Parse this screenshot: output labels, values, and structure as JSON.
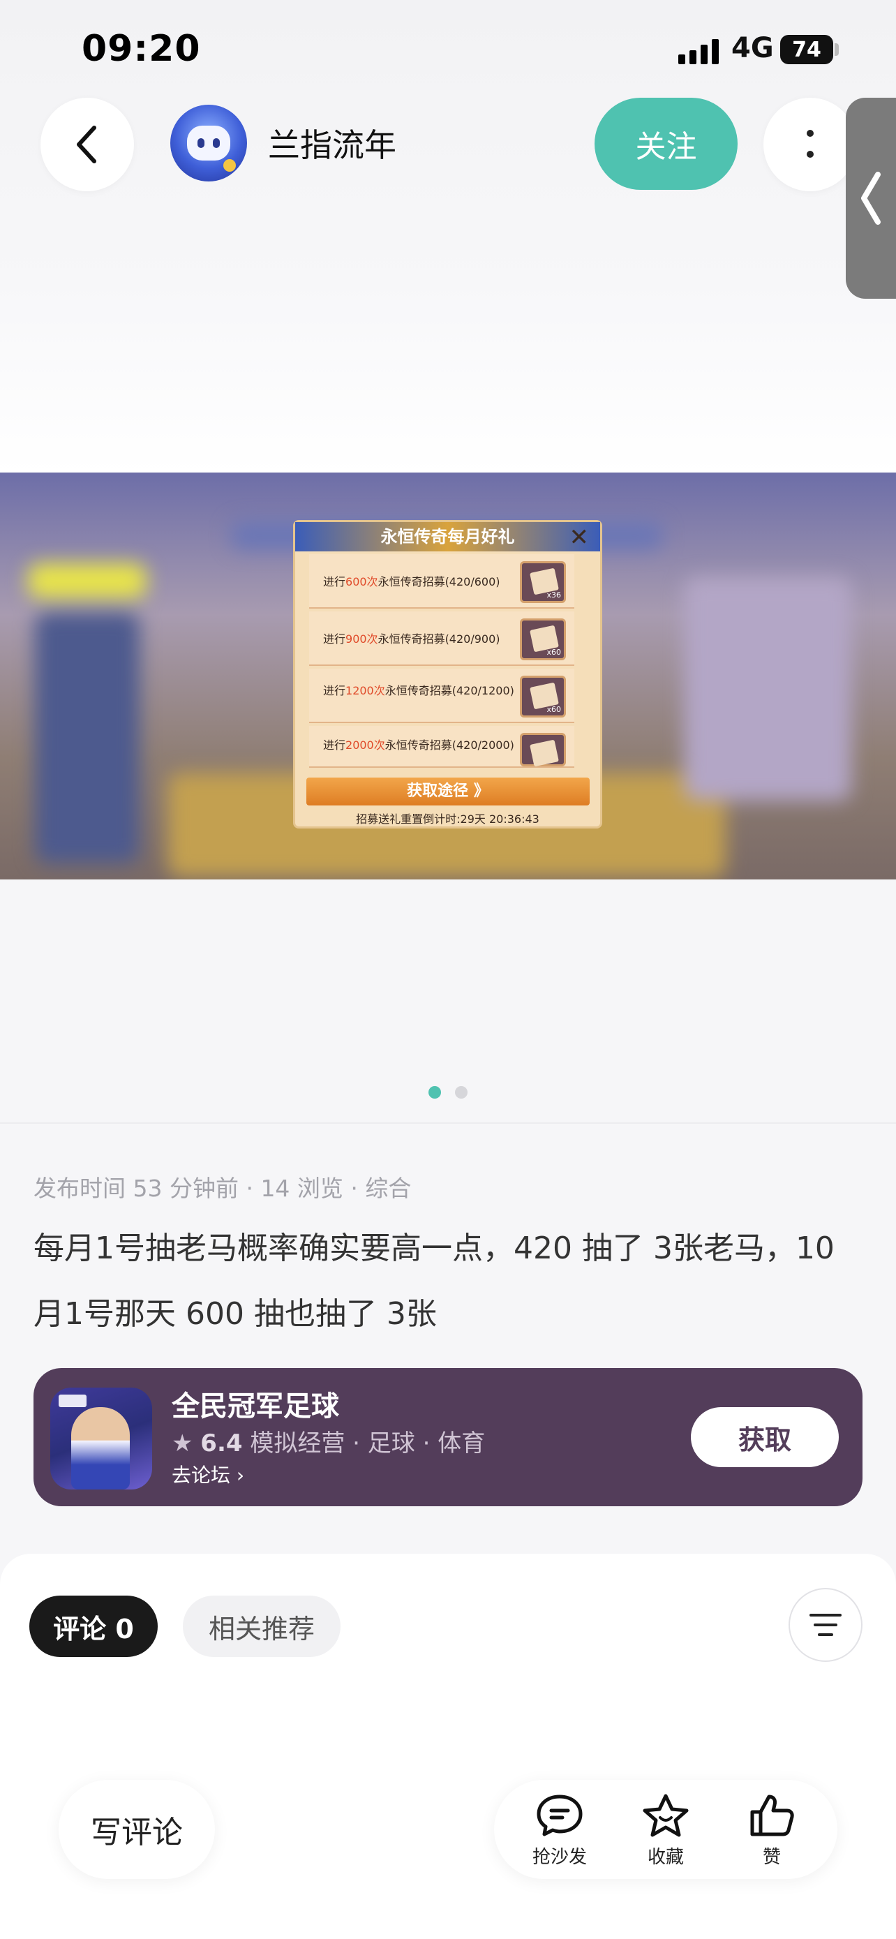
{
  "status_bar": {
    "time": "09:20",
    "network": "4G",
    "battery": "74"
  },
  "header": {
    "username": "兰指流年",
    "follow_label": "关注"
  },
  "image_popup": {
    "title": "永恒传奇每月好礼",
    "rows": [
      {
        "prefix": "进行",
        "count": "600次",
        "suffix": "永恒传奇招募(420/600)",
        "qty": "x36"
      },
      {
        "prefix": "进行",
        "count": "900次",
        "suffix": "永恒传奇招募(420/900)",
        "qty": "x60"
      },
      {
        "prefix": "进行",
        "count": "1200次",
        "suffix": "永恒传奇招募(420/1200)",
        "qty": "x60"
      },
      {
        "prefix": "进行",
        "count": "2000次",
        "suffix": "永恒传奇招募(420/2000)",
        "qty": ""
      }
    ],
    "button": "获取途径 》",
    "footer": "招募送礼重置倒计时:29天 20:36:43"
  },
  "carousel": {
    "count": 2,
    "active_index": 0
  },
  "post": {
    "meta": "发布时间 53 分钟前 · 14 浏览 · 综合",
    "content": "每月1号抽老马概率确实要高一点，420 抽了 3张老马，10月1号那天 600 抽也抽了 3张"
  },
  "app_card": {
    "name": "全民冠军足球",
    "rating": "6.4",
    "tags": "模拟经营 · 足球 · 体育",
    "forum_link": "去论坛",
    "get_label": "获取"
  },
  "comments": {
    "tab_comments": "评论 0",
    "tab_related": "相关推荐"
  },
  "bottom_bar": {
    "write_label": "写评论",
    "sofa_label": "抢沙发",
    "favorite_label": "收藏",
    "like_label": "赞"
  },
  "colors": {
    "accent": "#4fc2b0",
    "app_card_bg": "#533d5a"
  }
}
